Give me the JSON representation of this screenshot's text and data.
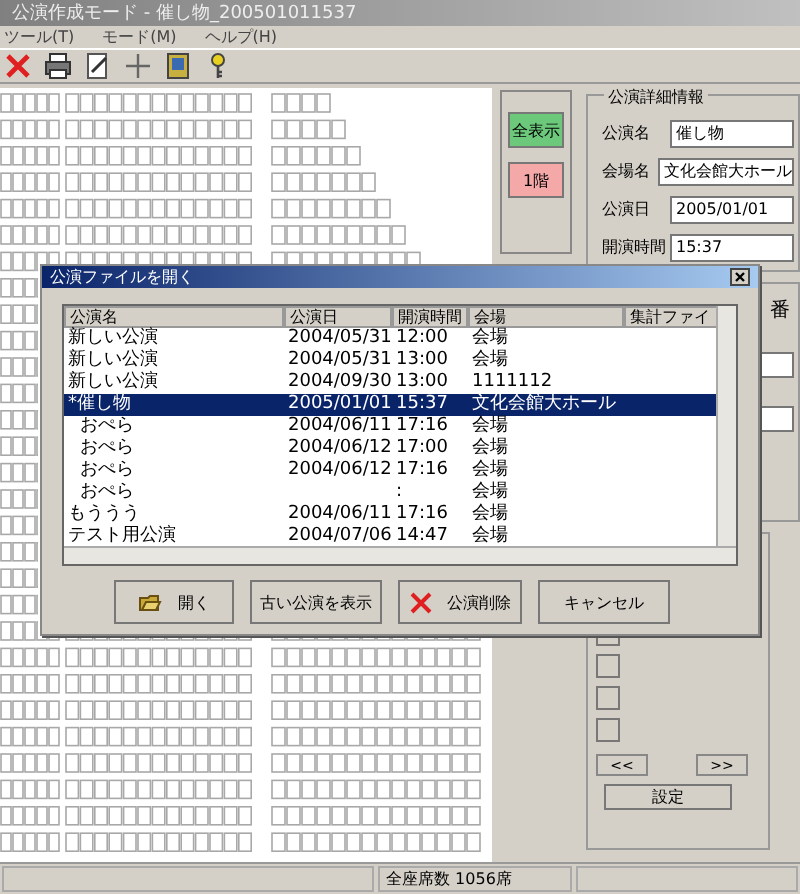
{
  "window": {
    "title": "公演作成モード - 催し物_200501011537"
  },
  "menu": [
    {
      "label": "ツール(T)"
    },
    {
      "label": "モード(M)"
    },
    {
      "label": "ヘルプ(H)"
    }
  ],
  "toolbar": [
    {
      "kind": "delete"
    },
    {
      "kind": "print"
    },
    {
      "kind": "edit"
    },
    {
      "kind": "add"
    },
    {
      "kind": "book"
    },
    {
      "kind": "key"
    }
  ],
  "view_buttons": [
    {
      "label": "全表示",
      "color": "#6cc87a"
    },
    {
      "label": "1階",
      "color": "#f4a8a8"
    }
  ],
  "details": {
    "title": "公演詳細情報",
    "fields": [
      {
        "label": "公演名",
        "value": "催し物"
      },
      {
        "label": "会場名",
        "value": "文化会館大ホール"
      },
      {
        "label": "公演日",
        "value": "2005/01/01"
      },
      {
        "label": "開演時間",
        "value": "15:37"
      }
    ]
  },
  "side_label": "番",
  "pager": [
    {
      "label": "<<"
    },
    {
      "label": ">>"
    }
  ],
  "apply_button": "設定",
  "status_bar": {
    "text": "全座席数 1056席"
  },
  "dialog": {
    "title": "公演ファイルを開く",
    "columns": [
      "公演名",
      "公演日",
      "開演時間",
      "会場",
      "集計ファイ"
    ],
    "rows": [
      {
        "cells": [
          "新しい公演",
          "2004/05/31",
          "12:00",
          "会場"
        ],
        "selected": false,
        "indent": false
      },
      {
        "cells": [
          "新しい公演",
          "2004/05/31",
          "13:00",
          "会場"
        ],
        "selected": false,
        "indent": false
      },
      {
        "cells": [
          "新しい公演",
          "2004/09/30",
          "13:00",
          "1111112"
        ],
        "selected": false,
        "indent": false
      },
      {
        "cells": [
          "*催し物",
          "2005/01/01",
          "15:37",
          "文化会館大ホール"
        ],
        "selected": true,
        "indent": false
      },
      {
        "cells": [
          "おぺら",
          "2004/06/11",
          "17:16",
          "会場"
        ],
        "selected": false,
        "indent": true
      },
      {
        "cells": [
          "おぺら",
          "2004/06/12",
          "17:00",
          "会場"
        ],
        "selected": false,
        "indent": true
      },
      {
        "cells": [
          "おぺら",
          "2004/06/12",
          "17:16",
          "会場"
        ],
        "selected": false,
        "indent": true
      },
      {
        "cells": [
          "おぺら",
          null,
          ":",
          "会場"
        ],
        "selected": false,
        "indent": true
      },
      {
        "cells": [
          "もううう",
          "2004/06/11",
          "17:16",
          "会場"
        ],
        "selected": false,
        "indent": false
      },
      {
        "cells": [
          "テスト用公演",
          "2004/07/06",
          "14:47",
          "会場"
        ],
        "selected": false,
        "indent": false
      }
    ],
    "buttons": [
      {
        "kind": "open",
        "label": "開く"
      },
      {
        "kind": "plain",
        "label": "古い公演を表示"
      },
      {
        "kind": "delete",
        "label": "公演削除"
      },
      {
        "kind": "plain",
        "label": "キャンセル"
      }
    ]
  }
}
